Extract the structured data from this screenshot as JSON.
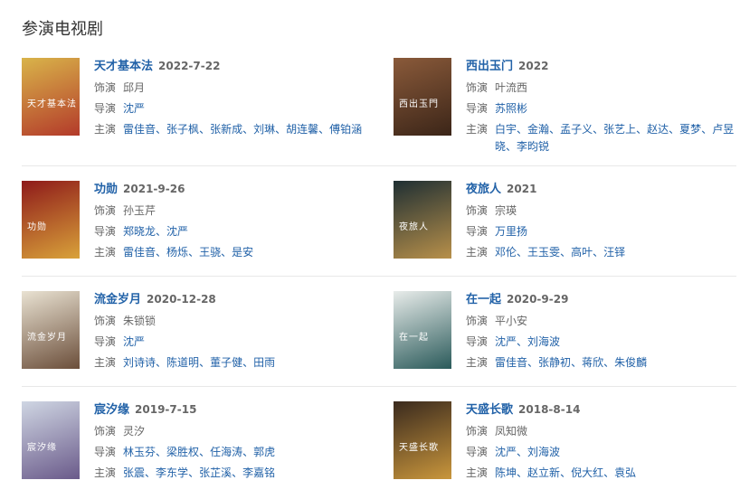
{
  "section": {
    "title": "参演电视剧"
  },
  "labels": {
    "role": "饰演",
    "director": "导演",
    "cast": "主演"
  },
  "shows": [
    {
      "title": "天才基本法",
      "date": "2022-7-22",
      "role": "邱月",
      "directors": [
        "沈严"
      ],
      "cast": [
        "雷佳音",
        "张子枫",
        "张新成",
        "刘琳",
        "胡连馨",
        "傅铂涵"
      ],
      "poster": {
        "bg": "#d9b44a",
        "accent": "#b33a2a",
        "text": "天才基本法"
      }
    },
    {
      "title": "西出玉门",
      "date": "2022",
      "role": "叶流西",
      "directors": [
        "苏照彬"
      ],
      "cast": [
        "白宇",
        "金瀚",
        "孟子义",
        "张艺上",
        "赵达",
        "夏梦",
        "卢昱晓",
        "李昀锐"
      ],
      "poster": {
        "bg": "#8a5a3a",
        "accent": "#3b2518",
        "text": "西出玉門"
      }
    },
    {
      "title": "功勋",
      "date": "2021-9-26",
      "role": "孙玉芹",
      "directors": [
        "郑晓龙",
        "沈严"
      ],
      "cast": [
        "雷佳音",
        "杨烁",
        "王骁",
        "是安"
      ],
      "poster": {
        "bg": "#8e1a1a",
        "accent": "#d9a23a",
        "text": "功勋"
      }
    },
    {
      "title": "夜旅人",
      "date": "2021",
      "role": "宗瑛",
      "directors": [
        "万里扬"
      ],
      "cast": [
        "邓伦",
        "王玉雯",
        "高叶",
        "汪铎"
      ],
      "poster": {
        "bg": "#1f2f33",
        "accent": "#b8904a",
        "text": "夜旅人"
      }
    },
    {
      "title": "流金岁月",
      "date": "2020-12-28",
      "role": "朱锁锁",
      "directors": [
        "沈严"
      ],
      "cast": [
        "刘诗诗",
        "陈道明",
        "董子健",
        "田雨"
      ],
      "poster": {
        "bg": "#e9e2d2",
        "accent": "#6b4e3a",
        "text": "流金岁月"
      }
    },
    {
      "title": "在一起",
      "date": "2020-9-29",
      "role": "平小安",
      "directors": [
        "沈严",
        "刘海波"
      ],
      "cast": [
        "雷佳音",
        "张静初",
        "蒋欣",
        "朱俊麟"
      ],
      "poster": {
        "bg": "#e8ecea",
        "accent": "#2a5a5a",
        "text": "在一起"
      }
    },
    {
      "title": "宸汐缘",
      "date": "2019-7-15",
      "role": "灵汐",
      "directors": [
        "林玉芬",
        "梁胜权",
        "任海涛",
        "郭虎"
      ],
      "cast": [
        "张震",
        "李东学",
        "张芷溪",
        "李嘉铭"
      ],
      "poster": {
        "bg": "#cfd6e3",
        "accent": "#6a5a8a",
        "text": "宸汐缘"
      }
    },
    {
      "title": "天盛长歌",
      "date": "2018-8-14",
      "role": "凤知微",
      "directors": [
        "沈严",
        "刘海波"
      ],
      "cast": [
        "陈坤",
        "赵立新",
        "倪大红",
        "袁弘"
      ],
      "poster": {
        "bg": "#3a2a1e",
        "accent": "#c9963c",
        "text": "天盛长歌"
      }
    }
  ]
}
